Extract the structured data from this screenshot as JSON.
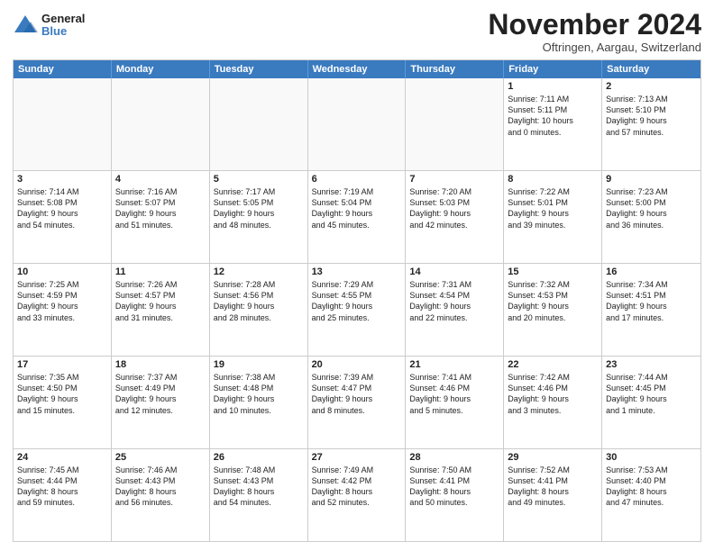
{
  "logo": {
    "general": "General",
    "blue": "Blue"
  },
  "header": {
    "month": "November 2024",
    "location": "Oftringen, Aargau, Switzerland"
  },
  "weekdays": [
    "Sunday",
    "Monday",
    "Tuesday",
    "Wednesday",
    "Thursday",
    "Friday",
    "Saturday"
  ],
  "weeks": [
    [
      {
        "day": "",
        "info": "",
        "shaded": true
      },
      {
        "day": "",
        "info": "",
        "shaded": true
      },
      {
        "day": "",
        "info": "",
        "shaded": true
      },
      {
        "day": "",
        "info": "",
        "shaded": true
      },
      {
        "day": "",
        "info": "",
        "shaded": true
      },
      {
        "day": "1",
        "info": "Sunrise: 7:11 AM\nSunset: 5:11 PM\nDaylight: 10 hours\nand 0 minutes."
      },
      {
        "day": "2",
        "info": "Sunrise: 7:13 AM\nSunset: 5:10 PM\nDaylight: 9 hours\nand 57 minutes."
      }
    ],
    [
      {
        "day": "3",
        "info": "Sunrise: 7:14 AM\nSunset: 5:08 PM\nDaylight: 9 hours\nand 54 minutes."
      },
      {
        "day": "4",
        "info": "Sunrise: 7:16 AM\nSunset: 5:07 PM\nDaylight: 9 hours\nand 51 minutes."
      },
      {
        "day": "5",
        "info": "Sunrise: 7:17 AM\nSunset: 5:05 PM\nDaylight: 9 hours\nand 48 minutes."
      },
      {
        "day": "6",
        "info": "Sunrise: 7:19 AM\nSunset: 5:04 PM\nDaylight: 9 hours\nand 45 minutes."
      },
      {
        "day": "7",
        "info": "Sunrise: 7:20 AM\nSunset: 5:03 PM\nDaylight: 9 hours\nand 42 minutes."
      },
      {
        "day": "8",
        "info": "Sunrise: 7:22 AM\nSunset: 5:01 PM\nDaylight: 9 hours\nand 39 minutes."
      },
      {
        "day": "9",
        "info": "Sunrise: 7:23 AM\nSunset: 5:00 PM\nDaylight: 9 hours\nand 36 minutes."
      }
    ],
    [
      {
        "day": "10",
        "info": "Sunrise: 7:25 AM\nSunset: 4:59 PM\nDaylight: 9 hours\nand 33 minutes."
      },
      {
        "day": "11",
        "info": "Sunrise: 7:26 AM\nSunset: 4:57 PM\nDaylight: 9 hours\nand 31 minutes."
      },
      {
        "day": "12",
        "info": "Sunrise: 7:28 AM\nSunset: 4:56 PM\nDaylight: 9 hours\nand 28 minutes."
      },
      {
        "day": "13",
        "info": "Sunrise: 7:29 AM\nSunset: 4:55 PM\nDaylight: 9 hours\nand 25 minutes."
      },
      {
        "day": "14",
        "info": "Sunrise: 7:31 AM\nSunset: 4:54 PM\nDaylight: 9 hours\nand 22 minutes."
      },
      {
        "day": "15",
        "info": "Sunrise: 7:32 AM\nSunset: 4:53 PM\nDaylight: 9 hours\nand 20 minutes."
      },
      {
        "day": "16",
        "info": "Sunrise: 7:34 AM\nSunset: 4:51 PM\nDaylight: 9 hours\nand 17 minutes."
      }
    ],
    [
      {
        "day": "17",
        "info": "Sunrise: 7:35 AM\nSunset: 4:50 PM\nDaylight: 9 hours\nand 15 minutes."
      },
      {
        "day": "18",
        "info": "Sunrise: 7:37 AM\nSunset: 4:49 PM\nDaylight: 9 hours\nand 12 minutes."
      },
      {
        "day": "19",
        "info": "Sunrise: 7:38 AM\nSunset: 4:48 PM\nDaylight: 9 hours\nand 10 minutes."
      },
      {
        "day": "20",
        "info": "Sunrise: 7:39 AM\nSunset: 4:47 PM\nDaylight: 9 hours\nand 8 minutes."
      },
      {
        "day": "21",
        "info": "Sunrise: 7:41 AM\nSunset: 4:46 PM\nDaylight: 9 hours\nand 5 minutes."
      },
      {
        "day": "22",
        "info": "Sunrise: 7:42 AM\nSunset: 4:46 PM\nDaylight: 9 hours\nand 3 minutes."
      },
      {
        "day": "23",
        "info": "Sunrise: 7:44 AM\nSunset: 4:45 PM\nDaylight: 9 hours\nand 1 minute."
      }
    ],
    [
      {
        "day": "24",
        "info": "Sunrise: 7:45 AM\nSunset: 4:44 PM\nDaylight: 8 hours\nand 59 minutes."
      },
      {
        "day": "25",
        "info": "Sunrise: 7:46 AM\nSunset: 4:43 PM\nDaylight: 8 hours\nand 56 minutes."
      },
      {
        "day": "26",
        "info": "Sunrise: 7:48 AM\nSunset: 4:43 PM\nDaylight: 8 hours\nand 54 minutes."
      },
      {
        "day": "27",
        "info": "Sunrise: 7:49 AM\nSunset: 4:42 PM\nDaylight: 8 hours\nand 52 minutes."
      },
      {
        "day": "28",
        "info": "Sunrise: 7:50 AM\nSunset: 4:41 PM\nDaylight: 8 hours\nand 50 minutes."
      },
      {
        "day": "29",
        "info": "Sunrise: 7:52 AM\nSunset: 4:41 PM\nDaylight: 8 hours\nand 49 minutes."
      },
      {
        "day": "30",
        "info": "Sunrise: 7:53 AM\nSunset: 4:40 PM\nDaylight: 8 hours\nand 47 minutes."
      }
    ]
  ]
}
